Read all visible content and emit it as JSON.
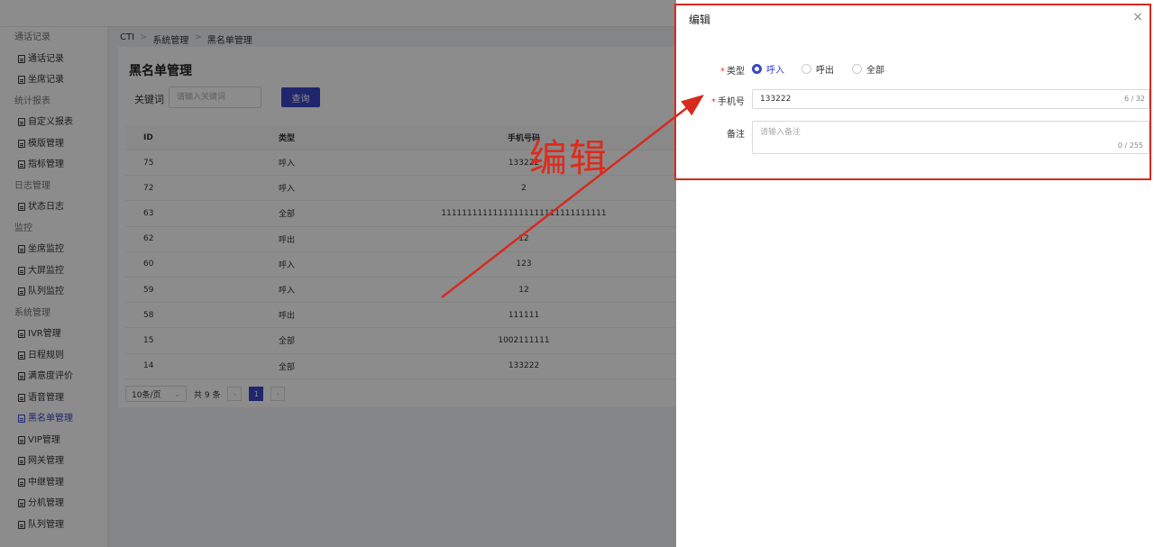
{
  "breadcrumb": [
    "CTI",
    "系统管理",
    "黑名单管理"
  ],
  "sidebar": [
    {
      "type": "group",
      "label": "通话记录"
    },
    {
      "type": "item",
      "label": "通话记录"
    },
    {
      "type": "item",
      "label": "坐席记录"
    },
    {
      "type": "group",
      "label": "统计报表"
    },
    {
      "type": "item",
      "label": "自定义报表"
    },
    {
      "type": "item",
      "label": "模版管理"
    },
    {
      "type": "item",
      "label": "指标管理"
    },
    {
      "type": "group",
      "label": "日志管理"
    },
    {
      "type": "item",
      "label": "状态日志"
    },
    {
      "type": "group",
      "label": "监控"
    },
    {
      "type": "item",
      "label": "坐席监控"
    },
    {
      "type": "item",
      "label": "大屏监控"
    },
    {
      "type": "item",
      "label": "队列监控"
    },
    {
      "type": "group",
      "label": "系统管理"
    },
    {
      "type": "item",
      "label": "IVR管理"
    },
    {
      "type": "item",
      "label": "日程规则"
    },
    {
      "type": "item",
      "label": "满意度评价"
    },
    {
      "type": "item",
      "label": "语音管理"
    },
    {
      "type": "item",
      "label": "黑名单管理",
      "active": true
    },
    {
      "type": "item",
      "label": "VIP管理"
    },
    {
      "type": "item",
      "label": "网关管理"
    },
    {
      "type": "item",
      "label": "中继管理"
    },
    {
      "type": "item",
      "label": "分机管理"
    },
    {
      "type": "item",
      "label": "队列管理"
    }
  ],
  "main": {
    "title": "黑名单管理",
    "keyword_label": "关键词",
    "keyword_placeholder": "请输入关键词",
    "query_label": "查询"
  },
  "table": {
    "headers": [
      "ID",
      "类型",
      "手机号码"
    ],
    "rows": [
      [
        "75",
        "呼入",
        "133222"
      ],
      [
        "72",
        "呼入",
        "2"
      ],
      [
        "63",
        "全部",
        "11111111111111111111111111111111"
      ],
      [
        "62",
        "呼出",
        "12"
      ],
      [
        "60",
        "呼入",
        "123"
      ],
      [
        "59",
        "呼入",
        "12"
      ],
      [
        "58",
        "呼出",
        "111111"
      ],
      [
        "15",
        "全部",
        "1002111111"
      ],
      [
        "14",
        "全部",
        "133222"
      ]
    ]
  },
  "pagination": {
    "page_size": "10条/页",
    "total": "共 9 条",
    "prev": "‹",
    "current": "1",
    "next": "›"
  },
  "drawer": {
    "title": "编辑",
    "close": "×",
    "type_label": "类型",
    "type_options": [
      "呼入",
      "呼出",
      "全部"
    ],
    "type_selected": "呼入",
    "phone_label": "手机号",
    "phone_value": "133222",
    "phone_count": "6 / 32",
    "remark_label": "备注",
    "remark_placeholder": "请输入备注",
    "remark_count": "0 / 255"
  },
  "annotation": {
    "text": "编辑",
    "color": "#e02a1b"
  },
  "colors": {
    "primary": "#3a46c9",
    "annotation_red": "#d62a1e"
  }
}
